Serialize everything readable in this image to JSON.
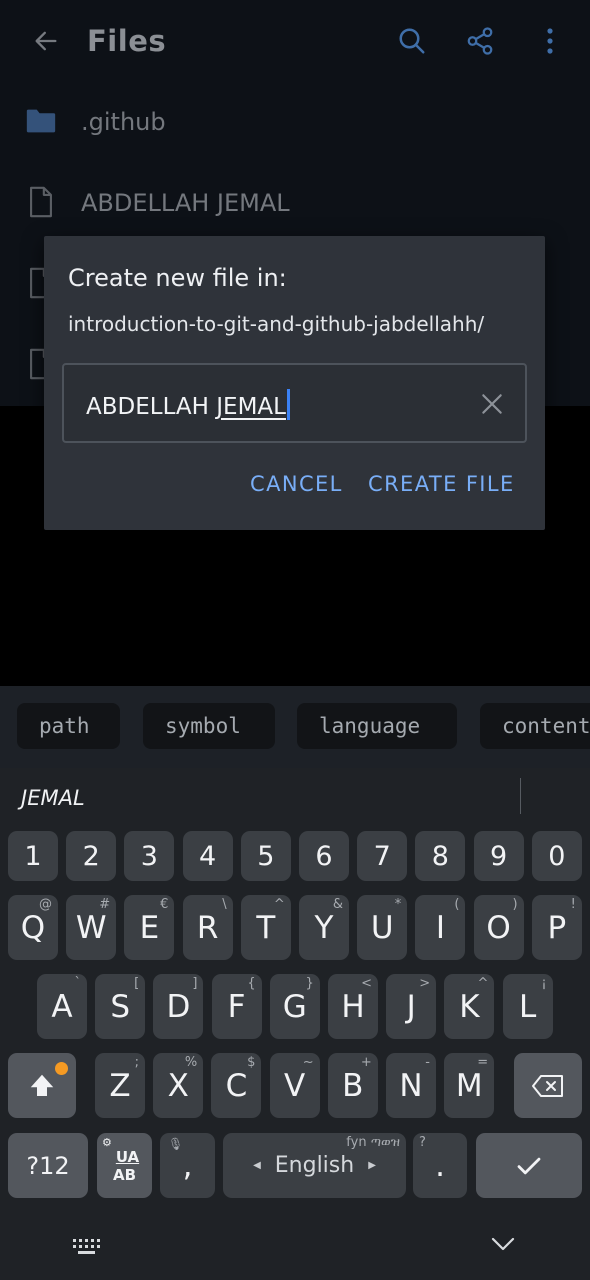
{
  "app": {
    "title": "Files",
    "files": [
      {
        "name": ".github",
        "type": "folder"
      },
      {
        "name": "ABDELLAH JEMAL",
        "type": "file"
      },
      {
        "name": "",
        "type": "file"
      },
      {
        "name": "",
        "type": "file"
      }
    ]
  },
  "dialog": {
    "title": "Create new file in:",
    "path": "introduction-to-git-and-github-jabdellahh/",
    "input_value_prefix": "ABDELLAH ",
    "input_value_composing": "JEMAL",
    "cancel_label": "CANCEL",
    "create_label": "CREATE FILE"
  },
  "chips": [
    "path",
    "symbol",
    "language",
    "content"
  ],
  "keyboard": {
    "suggestion": "JEMAL",
    "number_row": [
      "1",
      "2",
      "3",
      "4",
      "5",
      "6",
      "7",
      "8",
      "9",
      "0"
    ],
    "row1": [
      {
        "k": "Q",
        "s": "@"
      },
      {
        "k": "W",
        "s": "#"
      },
      {
        "k": "E",
        "s": "€"
      },
      {
        "k": "R",
        "s": "\\"
      },
      {
        "k": "T",
        "s": "^"
      },
      {
        "k": "Y",
        "s": "&"
      },
      {
        "k": "U",
        "s": "*"
      },
      {
        "k": "I",
        "s": "("
      },
      {
        "k": "O",
        "s": ")"
      },
      {
        "k": "P",
        "s": "!"
      }
    ],
    "row2": [
      {
        "k": "A",
        "s": "`"
      },
      {
        "k": "S",
        "s": "["
      },
      {
        "k": "D",
        "s": "]"
      },
      {
        "k": "F",
        "s": "{"
      },
      {
        "k": "G",
        "s": "}"
      },
      {
        "k": "H",
        "s": "<"
      },
      {
        "k": "J",
        "s": ">"
      },
      {
        "k": "K",
        "s": "^"
      },
      {
        "k": "L",
        "s": "¡"
      }
    ],
    "row3": [
      {
        "k": "Z",
        "s": ";"
      },
      {
        "k": "X",
        "s": "%"
      },
      {
        "k": "C",
        "s": "$"
      },
      {
        "k": "V",
        "s": "~"
      },
      {
        "k": "B",
        "s": "+"
      },
      {
        "k": "N",
        "s": "-"
      },
      {
        "k": "M",
        "s": "="
      }
    ],
    "sym_label": "?12",
    "lang_switch_top": "UA",
    "lang_switch_bottom": "AB",
    "comma": ",",
    "space_label": "English",
    "space_hint": "fyn ጣወዝ",
    "period": ".",
    "period_hint": "?"
  },
  "colors": {
    "accent": "#79aef7",
    "caret": "#3b82f6",
    "shift_dot": "#f59a23"
  }
}
